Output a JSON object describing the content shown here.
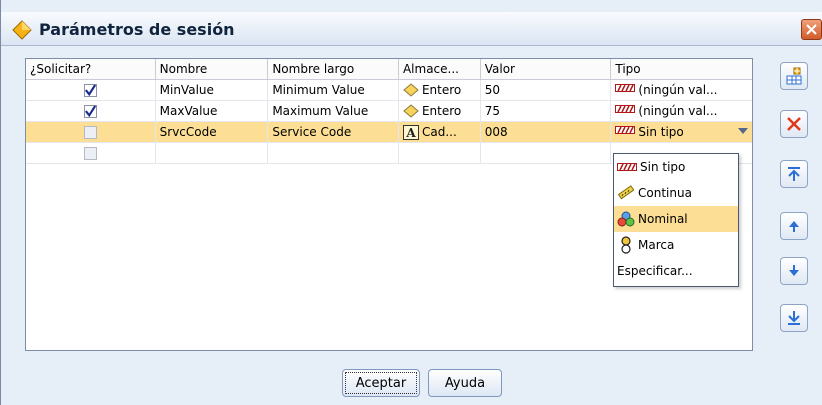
{
  "window": {
    "title": "Parámetros de sesión",
    "close_label": "X"
  },
  "table": {
    "headers": [
      "¿Solicitar?",
      "Nombre",
      "Nombre largo",
      "Almace...",
      "Valor",
      "Tipo"
    ],
    "rows": [
      {
        "prompt": true,
        "name": "MinValue",
        "long_name": "Minimum Value",
        "storage": "Entero",
        "storage_icon": "integer-icon",
        "value": "50",
        "type": "(ningún val...",
        "type_icon": "no-type-icon"
      },
      {
        "prompt": true,
        "name": "MaxValue",
        "long_name": "Maximum Value",
        "storage": "Entero",
        "storage_icon": "integer-icon",
        "value": "75",
        "type": "(ningún val...",
        "type_icon": "no-type-icon"
      },
      {
        "prompt": false,
        "name": "SrvcCode",
        "long_name": "Service Code",
        "storage": "Cad...",
        "storage_icon": "string-icon",
        "value": "008",
        "type": "Sin tipo",
        "type_icon": "no-type-icon",
        "selected": true
      },
      {
        "prompt": false,
        "name": "",
        "long_name": "",
        "storage": "",
        "value": "",
        "type": "",
        "empty": true
      }
    ]
  },
  "type_dropdown": {
    "options": [
      {
        "label": "Sin tipo",
        "icon": "no-type-icon"
      },
      {
        "label": "Continua",
        "icon": "ruler-icon"
      },
      {
        "label": "Nominal",
        "icon": "nominal-icon",
        "highlighted": true
      },
      {
        "label": "Marca",
        "icon": "flag-icon"
      },
      {
        "label": "Especificar...",
        "icon": ""
      }
    ]
  },
  "side_buttons": [
    "add-parameter",
    "delete-parameter",
    "move-top",
    "move-up",
    "move-down",
    "move-bottom"
  ],
  "footer": {
    "ok_label": "Aceptar",
    "help_label": "Ayuda"
  },
  "colors": {
    "selection": "#fcdf95",
    "window_bg": "#e6eef8",
    "delete_red": "#e03a1a",
    "arrow_blue": "#2b6fd6"
  }
}
